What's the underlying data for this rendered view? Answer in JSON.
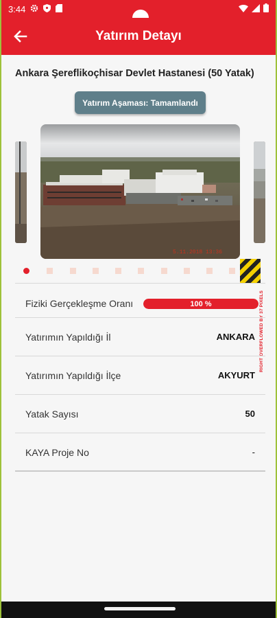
{
  "status_bar": {
    "time": "3:44",
    "icons": [
      "settings-icon",
      "shield-icon",
      "sd-card-icon",
      "wifi-icon",
      "signal-icon",
      "battery-icon"
    ]
  },
  "app_bar": {
    "title": "Yatırım Detayı",
    "back_icon": "arrow-left-icon"
  },
  "investment": {
    "title": "Ankara Şereflikoçhisar Devlet Hastanesi (50 Yatak)",
    "stage_label": "Yatırım Aşaması: Tamamlandı",
    "image_timestamp": "5.11.2018  13:36",
    "overflow_warning": "RIGHT OVERFLOWED BY 37 PIXELS",
    "carousel": {
      "total_pages": 10,
      "active_page": 1
    },
    "progress": {
      "label": "Fiziki Gerçekleşme Oranı",
      "value_text": "100 %",
      "fraction": 1.0
    },
    "details": [
      {
        "label": "Yatırımın Yapıldığı İl",
        "value": "ANKARA"
      },
      {
        "label": "Yatırımın Yapıldığı İlçe",
        "value": "AKYURT"
      },
      {
        "label": "Yatak Sayısı",
        "value": "50"
      },
      {
        "label": "KAYA Proje No",
        "value": "-"
      }
    ]
  },
  "colors": {
    "primary": "#e3202b",
    "badge": "#5f7f8a",
    "background": "#f6f6f6",
    "dot_inactive": "#f6d9cf"
  }
}
